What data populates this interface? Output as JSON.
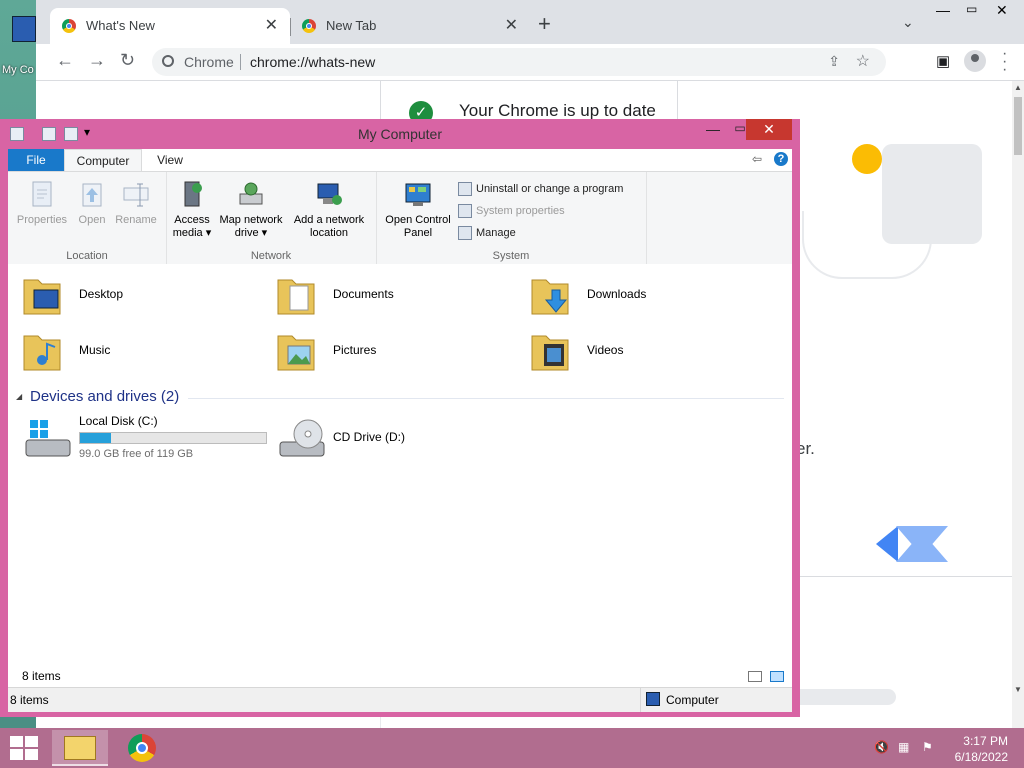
{
  "desktop": {
    "icon_label": "My Co"
  },
  "chrome": {
    "tabs": [
      {
        "title": "What's New",
        "active": true
      },
      {
        "title": "New Tab",
        "active": false
      }
    ],
    "new_tab": "+",
    "omnibox": {
      "site": "Chrome",
      "url": "chrome://whats-new"
    },
    "page": {
      "status_message": "Your Chrome is up to date",
      "partial_text": "er."
    }
  },
  "explorer": {
    "title": "My Computer",
    "ribbon_tabs": {
      "file": "File",
      "computer": "Computer",
      "view": "View"
    },
    "groups": {
      "location": {
        "label": "Location",
        "buttons": [
          {
            "label": "Properties",
            "enabled": false
          },
          {
            "label": "Open",
            "enabled": false
          },
          {
            "label": "Rename",
            "enabled": false
          }
        ]
      },
      "network": {
        "label": "Network",
        "access_media": "Access",
        "access_media_2": "media ▾",
        "map_drive": "Map network",
        "map_drive_2": "drive ▾",
        "add_location": "Add a network",
        "add_location_2": "location"
      },
      "system": {
        "label": "System",
        "open_cp": "Open Control",
        "open_cp_2": "Panel",
        "uninstall": "Uninstall or change a program",
        "sys_props": "System properties",
        "manage": "Manage"
      }
    },
    "folders": [
      "Desktop",
      "Documents",
      "Downloads",
      "Music",
      "Pictures",
      "Videos"
    ],
    "devices_header": "Devices and drives (2)",
    "drives": [
      {
        "name": "Local Disk (C:)",
        "free": "99.0 GB free of 119 GB",
        "used_fraction": 0.168
      },
      {
        "name": "CD Drive (D:)"
      }
    ],
    "item_count": "8 items",
    "status": {
      "count": "8 items",
      "location": "Computer"
    }
  },
  "taskbar": {
    "time": "3:17 PM",
    "date": "6/18/2022"
  },
  "colors": {
    "explorer_frame": "#d864a4",
    "taskbar": "#b16d8f",
    "accent": "#1979ca",
    "close": "#c7372f"
  }
}
